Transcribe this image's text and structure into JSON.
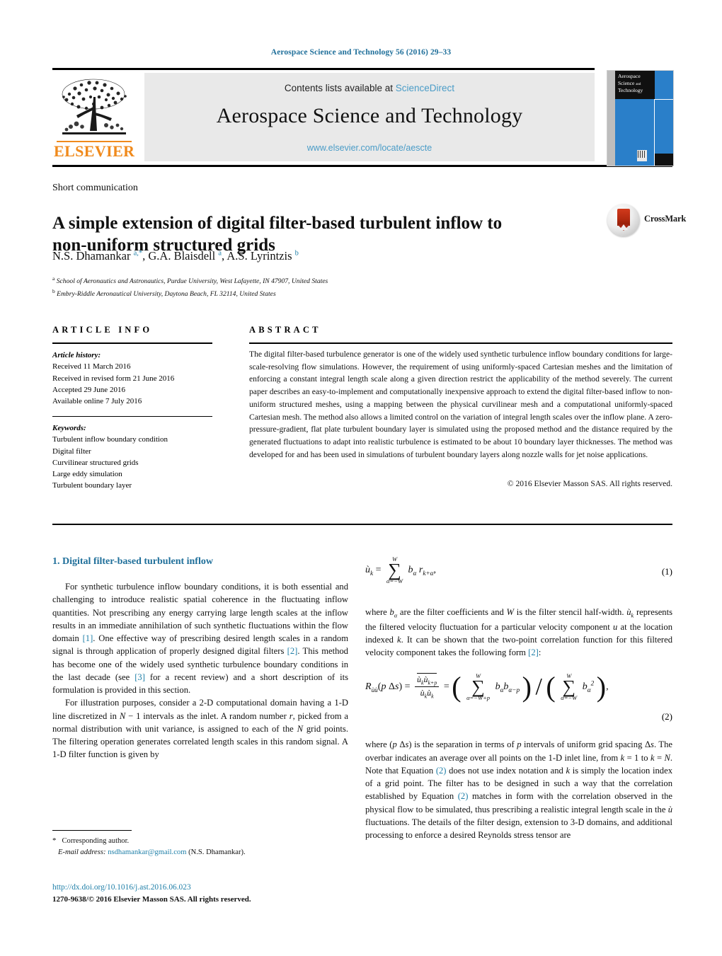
{
  "running_head": "Aerospace Science and Technology 56 (2016) 29–33",
  "masthead": {
    "publisher_name": "ELSEVIER",
    "contents_prefix": "Contents lists available at",
    "contents_link": "ScienceDirect",
    "journal_name": "Aerospace Science and Technology",
    "journal_url": "www.elsevier.com/locate/aescte",
    "cover_title_line1": "Aerospace",
    "cover_title_line2": "Science",
    "cover_title_line3": "and",
    "cover_title_line4": "Technology"
  },
  "article": {
    "type": "Short communication",
    "title": "A simple extension of digital filter-based turbulent inflow to non-uniform structured grids",
    "authors_html": "N.S. Dhamankar <sup>a,*</sup>, G.A. Blaisdell <sup>a</sup>, A.S. Lyrintzis <sup>b</sup>",
    "affiliations": [
      {
        "marker": "a",
        "text": "School of Aeronautics and Astronautics, Purdue University, West Lafayette, IN 47907, United States"
      },
      {
        "marker": "b",
        "text": "Embry-Riddle Aeronautical University, Daytona Beach, FL 32114, United States"
      }
    ],
    "crossmark_label": "CrossMark"
  },
  "info": {
    "heading": "ARTICLE INFO",
    "history_label": "Article history:",
    "history": [
      "Received 11 March 2016",
      "Received in revised form 21 June 2016",
      "Accepted 29 June 2016",
      "Available online 7 July 2016"
    ],
    "keywords_label": "Keywords:",
    "keywords": [
      "Turbulent inflow boundary condition",
      "Digital filter",
      "Curvilinear structured grids",
      "Large eddy simulation",
      "Turbulent boundary layer"
    ]
  },
  "abstract": {
    "heading": "ABSTRACT",
    "text": "The digital filter-based turbulence generator is one of the widely used synthetic turbulence inflow boundary conditions for large-scale-resolving flow simulations. However, the requirement of using uniformly-spaced Cartesian meshes and the limitation of enforcing a constant integral length scale along a given direction restrict the applicability of the method severely. The current paper describes an easy-to-implement and computationally inexpensive approach to extend the digital filter-based inflow to non-uniform structured meshes, using a mapping between the physical curvilinear mesh and a computational uniformly-spaced Cartesian mesh. The method also allows a limited control on the variation of integral length scales over the inflow plane. A zero-pressure-gradient, flat plate turbulent boundary layer is simulated using the proposed method and the distance required by the generated fluctuations to adapt into realistic turbulence is estimated to be about 10 boundary layer thicknesses. The method was developed for and has been used in simulations of turbulent boundary layers along nozzle walls for jet noise applications.",
    "copyright": "© 2016 Elsevier Masson SAS. All rights reserved."
  },
  "body": {
    "section_heading": "1. Digital filter-based turbulent inflow",
    "left_paragraph_1_html": "For synthetic turbulence inflow boundary conditions, it is both essential and challenging to introduce realistic spatial coherence in the fluctuating inflow quantities. Not prescribing any energy carrying large length scales at the inflow results in an immediate annihilation of such synthetic fluctuations within the flow domain <span class=\"ref\">[1]</span>. One effective way of prescribing desired length scales in a random signal is through application of properly designed digital filters <span class=\"ref\">[2]</span>. This method has become one of the widely used synthetic turbulence boundary conditions in the last decade (see <span class=\"ref\">[3]</span> for a recent review) and a short description of its formulation is provided in this section.",
    "left_paragraph_2_html": "For illustration purposes, consider a 2-D computational domain having a 1-D line discretized in <span class=\"mi\">N</span> &minus; 1 intervals as the inlet. A random number <span class=\"mi\">r</span>, picked from a normal distribution with unit variance, is assigned to each of the <span class=\"mi\">N</span> grid points. The filtering operation generates correlated length scales in this random signal. A 1-D filter function is given by",
    "equation_1_number": "(1)",
    "equation_2_number": "(2)",
    "right_paragraph_1_html": "where <span class=\"mi\">b<sub>&alpha;</sub></span> are the filter coefficients and <span class=\"mi\">W</span> is the filter stencil half-width. <span class=\"mi\">ù<sub>k</sub></span> represents the filtered velocity fluctuation for a particular velocity component <span class=\"mi\">u</span> at the location indexed <span class=\"mi\">k</span>. It can be shown that the two-point correlation function for this filtered velocity component takes the following form <span class=\"ref\">[2]</span>:",
    "right_paragraph_2_html": "where (<span class=\"mi\">p</span> &Delta;<span class=\"mi\">s</span>) is the separation in terms of <span class=\"mi\">p</span> intervals of uniform grid spacing &Delta;<span class=\"mi\">s</span>. The overbar indicates an average over all points on the 1-D inlet line, from <span class=\"mi\">k</span> = 1 to <span class=\"mi\">k</span> = <span class=\"mi\">N</span>. Note that Equation <span class=\"ref\">(2)</span> does not use index notation and <span class=\"mi\">k</span> is simply the location index of a grid point. The filter has to be designed in such a way that the correlation established by Equation <span class=\"ref\">(2)</span> matches in form with the correlation observed in the physical flow to be simulated, thus prescribing a realistic integral length scale in the <span class=\"mi\">ù</span> fluctuations. The details of the filter design, extension to 3-D domains, and additional processing to enforce a desired Reynolds stress tensor are"
  },
  "footer": {
    "corresponding_marker": "*",
    "corresponding_text": "Corresponding author.",
    "email_label": "E-mail address:",
    "email": "nsdhamankar@gmail.com",
    "email_owner": "(N.S. Dhamankar).",
    "doi": "http://dx.doi.org/10.1016/j.ast.2016.06.023",
    "issn_line": "1270-9638/© 2016 Elsevier Masson SAS. All rights reserved."
  },
  "colors": {
    "link_blue": "#1f7fa8",
    "header_blue": "#1f6f9a",
    "sciencedirect_blue": "#4a9cc7",
    "elsevier_orange": "#f08a1c",
    "cover_blue": "#2a7fc9",
    "crossmark_red": "#b32a10"
  }
}
